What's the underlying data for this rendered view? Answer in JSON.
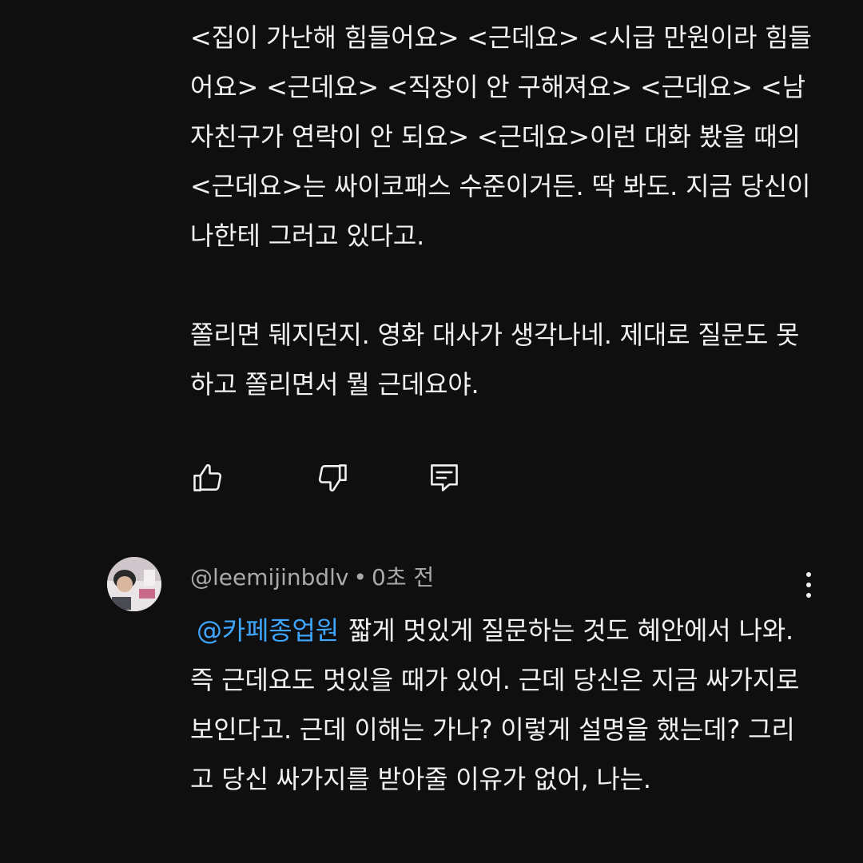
{
  "previous_comment": {
    "paragraphs": [
      "<집이 가난해 힘들어요> <근데요> <시급 만원이라 힘들어요> <근데요> <직장이 안 구해져요> <근데요> <남자친구가 연락이 안 되요> <근데요>이런 대화 봤을 때의 <근데요>는 싸이코패스 수준이거든. 딱 봐도. 지금 당신이 나한테 그러고 있다고.",
      "쫄리면 뒈지던지. 영화 대사가 생각나네. 제대로 질문도 못하고 쫄리면서 뭘 근데요야."
    ],
    "actions": {
      "like_icon": "thumb-up-icon",
      "dislike_icon": "thumb-down-icon",
      "reply_icon": "comment-reply-icon"
    }
  },
  "reply_comment": {
    "author_handle": "@leemijinbdlv",
    "separator": "•",
    "timestamp": "0초 전",
    "mention": "@카페종업원",
    "text": "짧게 멋있게 질문하는 것도 혜안에서 나와. 즉 근데요도 멋있을 때가 있어. 근데 당신은 지금 싸가지로 보인다고. 근데 이해는 가나? 이렇게 설명을 했는데? 그리고 당신 싸가지를 받아줄 이유가 없어, 나는.",
    "more_icon": "more-vertical-icon"
  },
  "colors": {
    "background": "#0f0f0f",
    "text": "#f1f1f1",
    "secondary_text": "#aaaaaa",
    "mention": "#3ea6ff"
  }
}
